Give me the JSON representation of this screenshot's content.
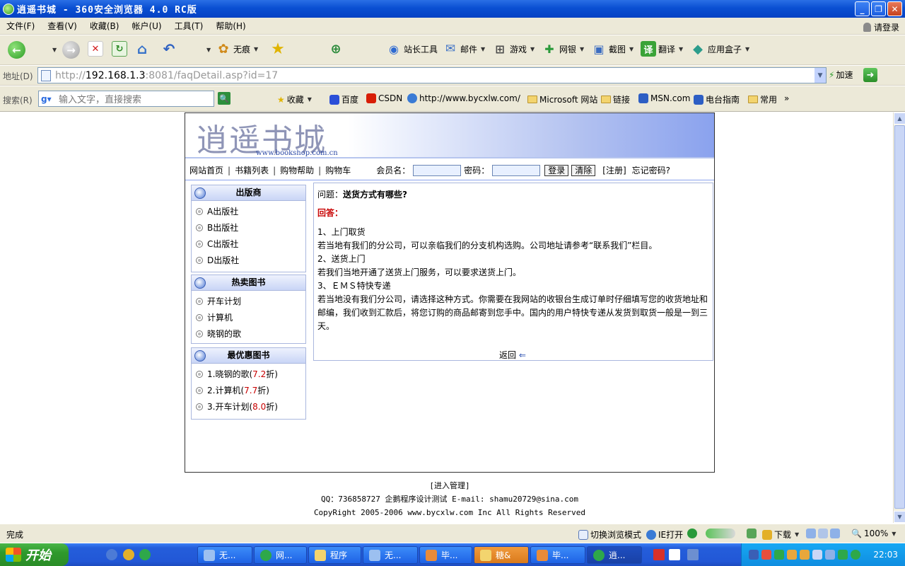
{
  "window": {
    "title": "逍遥书城 - 360安全浏览器 4.0 RC版"
  },
  "menu": {
    "items": [
      "文件(F)",
      "查看(V)",
      "收藏(B)",
      "帐户(U)",
      "工具(T)",
      "帮助(H)"
    ],
    "login": "请登录"
  },
  "toolbar": {
    "no_trace": "无痕",
    "webmaster": "站长工具",
    "mail": "邮件",
    "games": "游戏",
    "bank": "网银",
    "screenshot": "截图",
    "translate": "翻译",
    "appbox": "应用盒子",
    "translate_glyph": "译"
  },
  "address": {
    "label": "地址(D)",
    "prefix": "http://",
    "host": "192.168.1.3",
    "rest": ":8081/faqDetail.asp?id=17",
    "speed": "加速"
  },
  "search": {
    "label": "搜索(R)",
    "placeholder": "输入文字，直接搜索"
  },
  "favorites": {
    "collect": "收藏",
    "items": [
      "百度",
      "CSDN",
      "http://www.bycxlw.com/",
      "Microsoft 网站",
      "链接",
      "MSN.com",
      "电台指南",
      "常用"
    ],
    "more": "»"
  },
  "site": {
    "logo": "逍遥书城",
    "logo_sub": "www.bookshop.com.cn",
    "nav": [
      "网站首页",
      "书籍列表",
      "购物帮助",
      "购物车"
    ],
    "nav_sep": "|",
    "member_label": "会员名：",
    "password_label": "密码：",
    "login_btn": "登录",
    "clear_btn": "清除",
    "register": "[注册]",
    "forgot": "忘记密码?",
    "publishers": {
      "title": "出版商",
      "items": [
        "A出版社",
        "B出版社",
        "C出版社",
        "D出版社"
      ]
    },
    "hot": {
      "title": "热卖图书",
      "items": [
        "开车计划",
        "计算机",
        "晓钢的歌"
      ]
    },
    "best": {
      "title": "最优惠图书",
      "items": [
        {
          "prefix": "1.晓钢的歌(",
          "discount": "7.2",
          "suffix": "折)"
        },
        {
          "prefix": "2.计算机(",
          "discount": "7.7",
          "suffix": "折)"
        },
        {
          "prefix": "3.开车计划(",
          "discount": "8.0",
          "suffix": "折)"
        }
      ]
    },
    "faq": {
      "q_label": "问题：",
      "question": "送货方式有哪些?",
      "a_label": "回答：",
      "lines": [
        "1、上门取货",
        "若当地有我们的分公司，可以亲临我们的分支机构选购。公司地址请参考“联系我们”栏目。",
        "2、送货上门",
        "若我们当地开通了送货上门服务，可以要求送货上门。",
        "3、ＥＭＳ特快专递",
        "若当地没有我们分公司，请选择这种方式。你需要在我网站的收银台生成订单时仔细填写您的收货地址和邮编，我们收到汇款后，将您订购的商品邮寄到您手中。国内的用户特快专递从发货到取货一般是一到三天。"
      ],
      "back": "返回",
      "back_arrow": "⇐"
    },
    "footer": {
      "admin": "[进入管理]",
      "contact": "QQ：736858727 企鹅程序设计测试 E-mail: shamu20729@sina.com",
      "copyright": "CopyRight 2005-2006 www.bycxlw.com Inc All Rights Reserved"
    }
  },
  "status": {
    "text": "完成",
    "switch": "切换浏览模式",
    "ie": "IE打开",
    "download": "下载",
    "zoom": "100%"
  },
  "taskbar": {
    "start": "开始",
    "tasks": [
      "无...",
      "网...",
      "程序",
      "无...",
      "毕...",
      "糖&",
      "毕...",
      "逍..."
    ],
    "clock": "22:03"
  }
}
